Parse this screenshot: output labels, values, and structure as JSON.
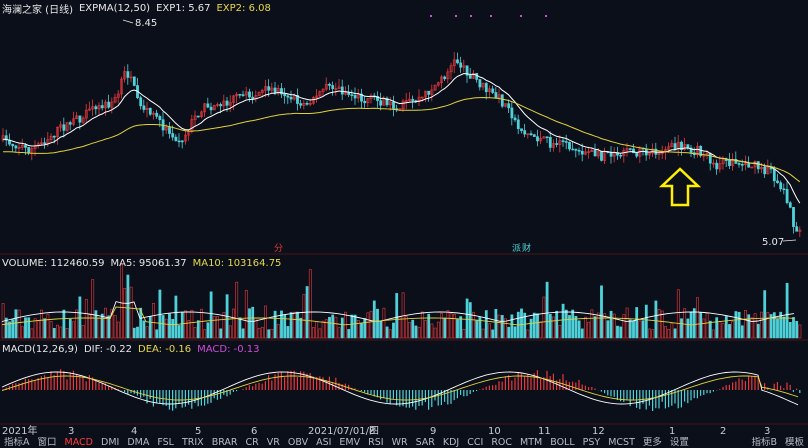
{
  "price_header": {
    "title": "海澜之家 (日线)",
    "indicator": "EXPMA(12,50)",
    "exp1": "EXP1: 5.67",
    "exp2": "EXP2: 6.08",
    "high_label": "8.45",
    "low_label": "5.07",
    "event_labels": [
      "分",
      "派"
    ],
    "event_label_2_suffix": "财"
  },
  "volume_header": {
    "volume": "VOLUME: 112460.59",
    "ma5": "MA5: 95061.37",
    "ma10": "MA10: 103164.75"
  },
  "macd_header": {
    "name": "MACD(12,26,9)",
    "dif": "DIF: -0.22",
    "dea": "DEA: -0.16",
    "macd": "MACD: -0.13"
  },
  "x_axis": [
    "2021年",
    "3",
    "4",
    "5",
    "6",
    "2021/07/01/四",
    "8",
    "9",
    "10",
    "11",
    "12",
    "1",
    "2",
    "3"
  ],
  "bottom_tabs": {
    "left": [
      "指标A",
      "窗口",
      "MACD",
      "DMI",
      "DMA",
      "FSL",
      "TRIX",
      "BRAR",
      "CR",
      "VR",
      "OBV",
      "ASI",
      "EMV",
      "RSI",
      "WR",
      "SAR",
      "KDJ",
      "CCI",
      "ROC",
      "MTM",
      "BOLL",
      "PSY",
      "MCST",
      "更多",
      "设置"
    ],
    "active": "MACD",
    "right": [
      "指标B",
      "模板"
    ]
  },
  "colors": {
    "up": "#e8393b",
    "down": "#4fd1d9",
    "exp1": "#ffffff",
    "exp2": "#e3d23a",
    "arrow": "#ffef00",
    "macd_label": "#d04bd8"
  },
  "icons": [
    "up-arrow-annotation-icon"
  ]
}
